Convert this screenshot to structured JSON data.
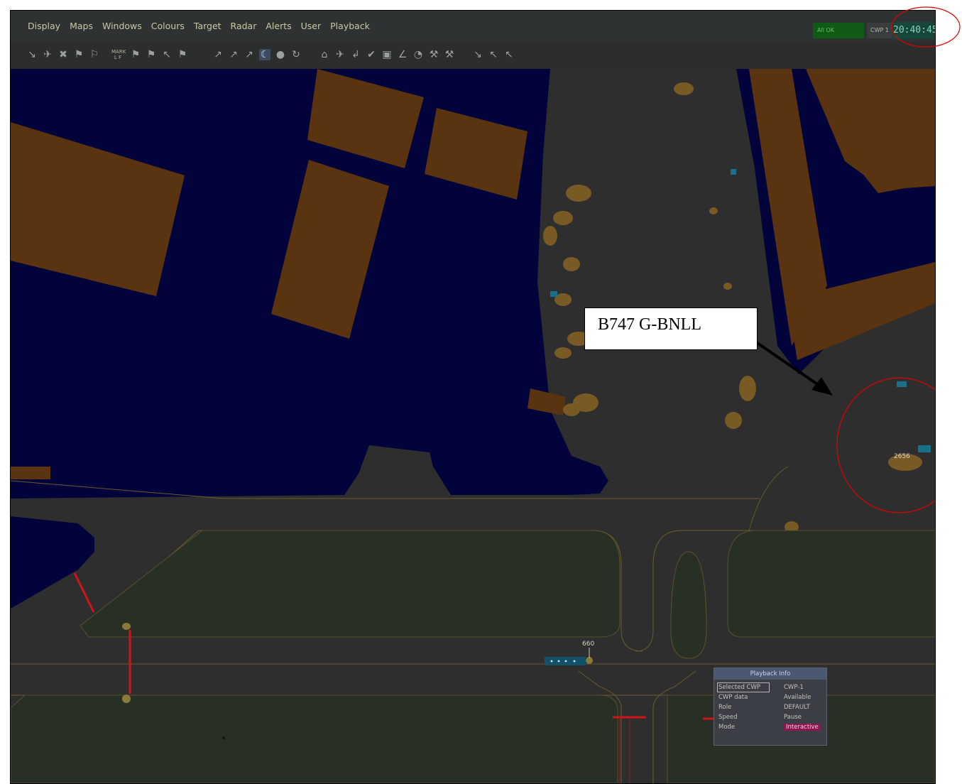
{
  "menu": {
    "items": [
      "Display",
      "Maps",
      "Windows",
      "Colours",
      "Target",
      "Radar",
      "Alerts",
      "User",
      "Playback"
    ]
  },
  "toolbar": {
    "mark_label_top": "MARK",
    "mark_label_bottom": "L F"
  },
  "status": {
    "green_box_text": "All OK",
    "cwp_text": "CWP 1",
    "clock": "20:40:45"
  },
  "map": {
    "target_left_label": "660",
    "target_right_label": "2656",
    "callout_text": "B747 G-BNLL"
  },
  "playback_info": {
    "title": "Playback Info",
    "rows": [
      {
        "label": "Selected CWP",
        "value": "CWP-1"
      },
      {
        "label": "CWP data",
        "value": "Available"
      },
      {
        "label": "Role",
        "value": "DEFAULT"
      },
      {
        "label": "Speed",
        "value": "Pause"
      },
      {
        "label": "Mode",
        "value": "Interactive"
      }
    ]
  },
  "colors": {
    "background": "#2e2e2e",
    "water": "#02033a",
    "building": "#5a3410",
    "annotation_circle": "#e00000",
    "stop_bar": "#d0151a",
    "taxiway_line": "#6b5a2a"
  }
}
